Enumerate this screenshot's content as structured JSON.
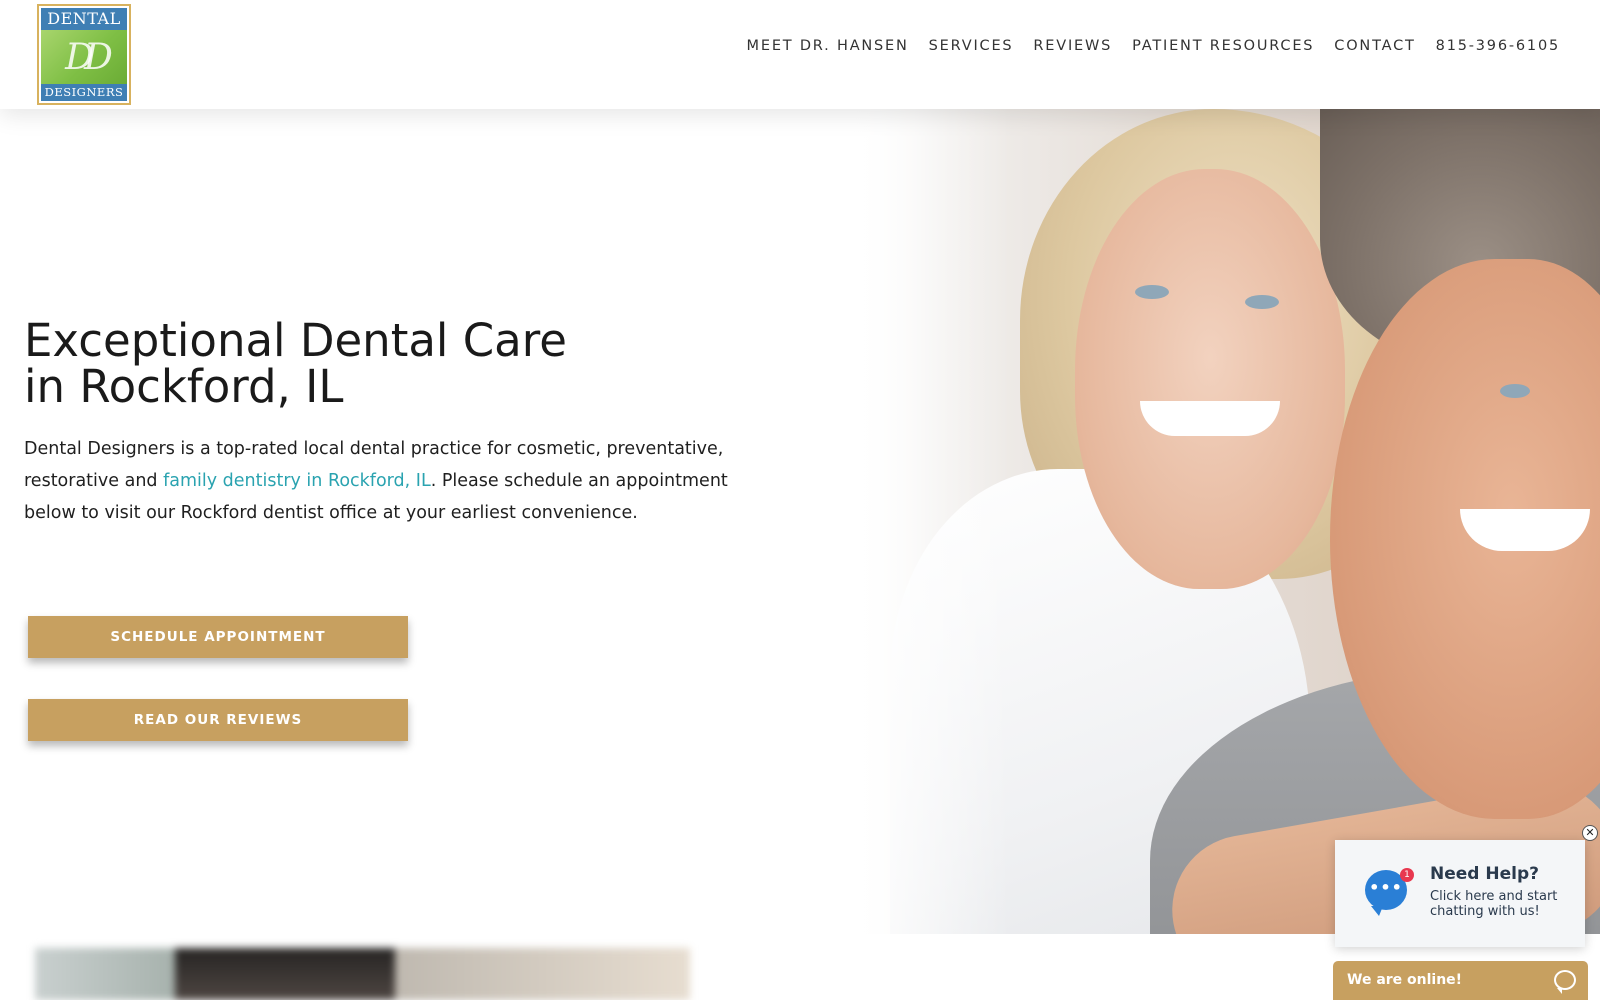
{
  "logo": {
    "top_text": "DENTAL",
    "monogram": "DD",
    "bottom_text": "DESIGNERS"
  },
  "nav": {
    "items": [
      {
        "label": "MEET DR. HANSEN"
      },
      {
        "label": "SERVICES"
      },
      {
        "label": "REVIEWS"
      },
      {
        "label": "PATIENT RESOURCES"
      },
      {
        "label": "CONTACT"
      },
      {
        "label": "815-396-6105"
      }
    ]
  },
  "hero": {
    "title_line1": "Exceptional Dental Care",
    "title_line2": "in Rockford, IL",
    "text_before_link": "Dental Designers is a top-rated local dental practice for cosmetic, preventative, restorative and ",
    "link_text": "family dentistry in Rockford, IL",
    "text_after_link": ". Please schedule an appointment below to visit our Rockford dentist office at your earliest convenience.",
    "schedule_button": "SCHEDULE APPOINTMENT",
    "reviews_button": "READ OUR REVIEWS"
  },
  "chat": {
    "close_symbol": "✕",
    "badge_count": "1",
    "dots": "•••",
    "heading": "Need Help?",
    "subtext": "Click here and start chatting with us!",
    "bar_label": "We are online!",
    "icon": "chat-bubble-icon"
  },
  "colors": {
    "accent_gold": "#c7a060",
    "link_teal": "#2aa3b0",
    "chat_blue": "#2a7fd6",
    "badge_red": "#e8384f"
  }
}
